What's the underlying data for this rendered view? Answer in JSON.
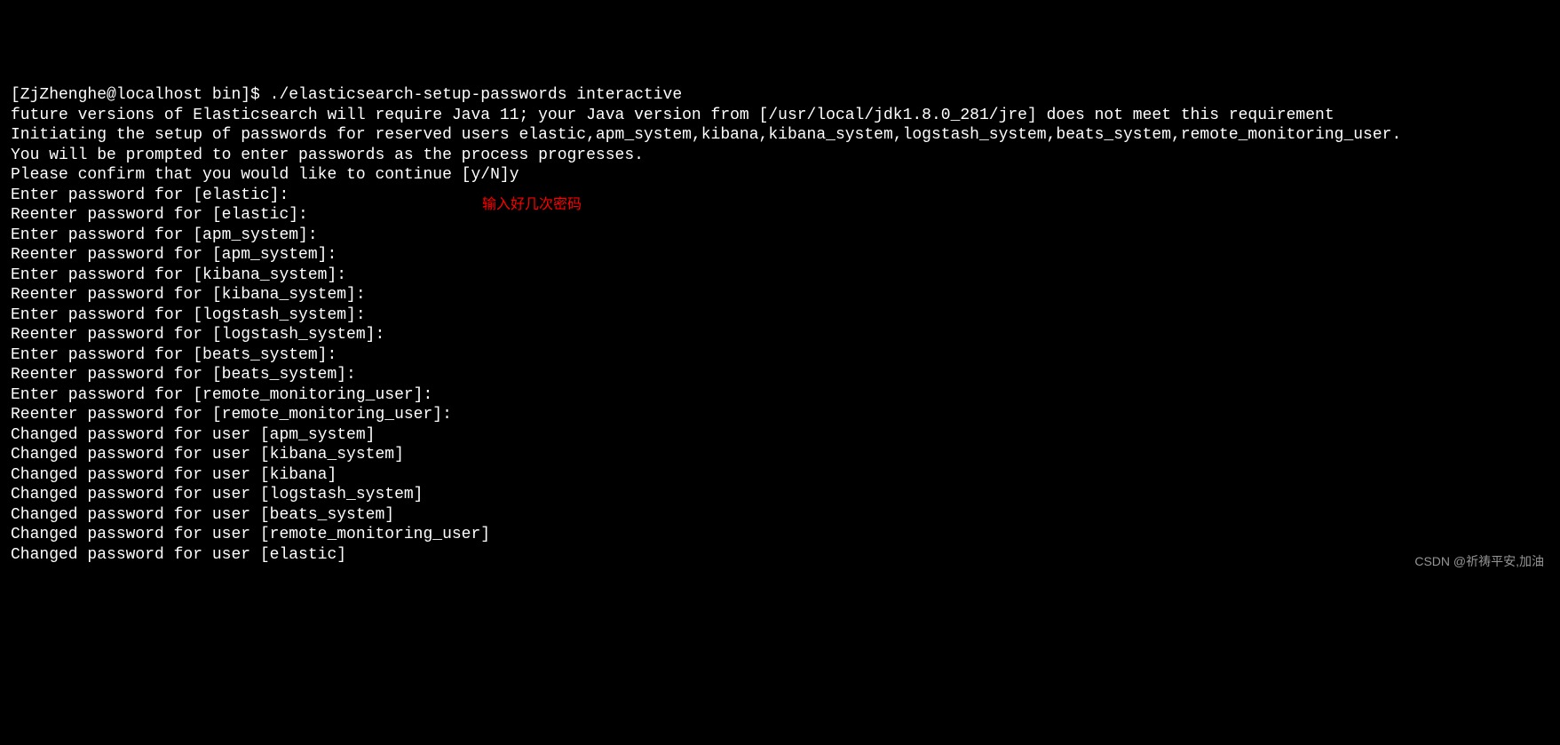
{
  "terminal": {
    "lines": [
      "[ZjZhenghe@localhost bin]$ ./elasticsearch-setup-passwords interactive",
      "future versions of Elasticsearch will require Java 11; your Java version from [/usr/local/jdk1.8.0_281/jre] does not meet this requirement",
      "Initiating the setup of passwords for reserved users elastic,apm_system,kibana,kibana_system,logstash_system,beats_system,remote_monitoring_user.",
      "You will be prompted to enter passwords as the process progresses.",
      "Please confirm that you would like to continue [y/N]y",
      "",
      "",
      "Enter password for [elastic]:",
      "Reenter password for [elastic]:",
      "Enter password for [apm_system]:",
      "Reenter password for [apm_system]:",
      "Enter password for [kibana_system]:",
      "Reenter password for [kibana_system]:",
      "Enter password for [logstash_system]:",
      "Reenter password for [logstash_system]:",
      "Enter password for [beats_system]:",
      "Reenter password for [beats_system]:",
      "Enter password for [remote_monitoring_user]:",
      "Reenter password for [remote_monitoring_user]:",
      "Changed password for user [apm_system]",
      "Changed password for user [kibana_system]",
      "Changed password for user [kibana]",
      "Changed password for user [logstash_system]",
      "Changed password for user [beats_system]",
      "Changed password for user [remote_monitoring_user]",
      "Changed password for user [elastic]"
    ]
  },
  "annotations": {
    "note1": "输入好几次密码"
  },
  "watermark": "CSDN @祈祷平安,加油"
}
